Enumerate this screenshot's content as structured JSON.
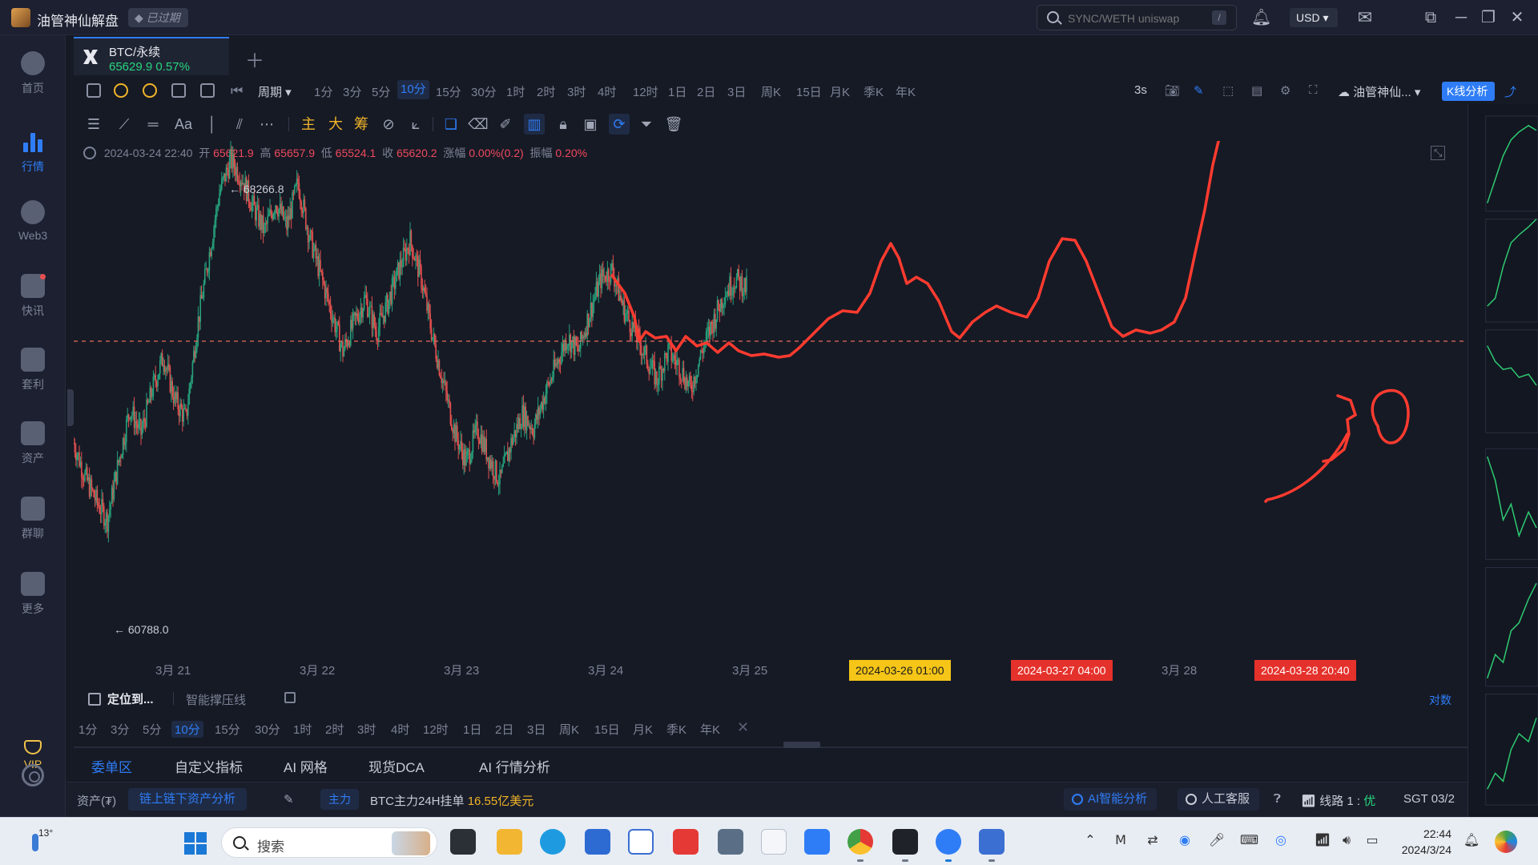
{
  "titlebar": {
    "app_name": "油管神仙解盘",
    "expired_badge": "已过期",
    "search_placeholder": "SYNC/WETH uniswap",
    "search_shortcut": "/",
    "currency": "USD"
  },
  "sidebar": {
    "items": [
      {
        "label": "首页",
        "icon": "home-icon"
      },
      {
        "label": "行情",
        "icon": "market-chart-icon"
      },
      {
        "label": "Web3",
        "icon": "web3-icon"
      },
      {
        "label": "快讯",
        "icon": "news-icon"
      },
      {
        "label": "套利",
        "icon": "arbitrage-icon"
      },
      {
        "label": "资产",
        "icon": "wallet-icon"
      },
      {
        "label": "群聊",
        "icon": "chat-icon"
      },
      {
        "label": "更多",
        "icon": "more-grid-icon"
      }
    ],
    "vip_label": "VIP"
  },
  "symbol_tab": {
    "name": "BTC/永续",
    "price_change": "65629.9  0.57%"
  },
  "toolbar1": {
    "period_label": "周期",
    "timeframes": [
      "1分",
      "3分",
      "5分",
      "10分",
      "15分",
      "30分",
      "1时",
      "2时",
      "3时",
      "4时",
      "12时",
      "1日",
      "2日",
      "3日",
      "周K",
      "15日",
      "月K",
      "季K",
      "年K"
    ],
    "active_timeframe": "10分",
    "refresh": "3s",
    "account": "油管神仙...",
    "k_analysis": "K线分析"
  },
  "toolbar2": {
    "text_tool": "Aa",
    "overlay_main": "主",
    "overlay_big": "大",
    "overlay_chips": "筹"
  },
  "ohlc": {
    "datetime": "2024-03-24 22:40",
    "open_label": "开",
    "open": "65621.9",
    "high_label": "高",
    "high": "65657.9",
    "low_label": "低",
    "low": "65524.1",
    "close_label": "收",
    "close": "65620.2",
    "change_label": "涨幅",
    "change": "0.00%(0.2)",
    "amplitude_label": "振幅",
    "amplitude": "0.20%"
  },
  "chart_data": {
    "type": "candlestick",
    "symbol": "BTC/永续",
    "interval": "10分",
    "high_marker": "← 68266.8",
    "low_marker": "← 60788.0",
    "current_price": 65620.2,
    "x_ticks": [
      "3月 21",
      "3月 22",
      "3月 23",
      "3月 24",
      "3月 25",
      "3月 28"
    ],
    "marked_dates": [
      {
        "label": "2024-03-26 01:00",
        "color": "#f5c518"
      },
      {
        "label": "2024-03-27 04:00",
        "color": "#e5312b"
      },
      {
        "label": "2024-03-28 20:40",
        "color": "#e5312b"
      }
    ],
    "closes": [
      62400,
      61700,
      61200,
      60800,
      62000,
      63100,
      62600,
      63500,
      64200,
      63300,
      62900,
      64800,
      66200,
      67600,
      68266,
      67900,
      67300,
      66800,
      67400,
      66900,
      67800,
      66700,
      65900,
      65100,
      64300,
      64900,
      65400,
      64700,
      65300,
      66000,
      66600,
      65800,
      64600,
      63600,
      62600,
      62000,
      62700,
      62100,
      61600,
      62400,
      63000,
      62700,
      63400,
      64000,
      64600,
      64300,
      65100,
      65800,
      66000,
      65200,
      64700,
      64200,
      63700,
      64300,
      64000,
      63500,
      64300,
      64900,
      65500,
      65800,
      65620
    ],
    "annotation_text": "30",
    "annotation_color": "#ff3b2f"
  },
  "bottom": {
    "locate": "定位到...",
    "smart_line": "智能撑压线",
    "log_scale": "对数",
    "timeframes": [
      "1分",
      "3分",
      "5分",
      "10分",
      "15分",
      "30分",
      "1时",
      "2时",
      "3时",
      "4时",
      "12时",
      "1日",
      "2日",
      "3日",
      "周K",
      "15日",
      "月K",
      "季K",
      "年K"
    ],
    "active_timeframe": "10分",
    "tabs": [
      "委单区",
      "自定义指标",
      "AI 网格",
      "现货DCA",
      "AI 行情分析"
    ],
    "active_tab": "委单区"
  },
  "statusbar": {
    "assets_label": "资产(₮)",
    "onchain_button": "链上链下资产分析",
    "main_badge": "主力",
    "main_text": "BTC主力24H挂单",
    "main_amount": "16.55亿美元",
    "ai_analysis": "AI智能分析",
    "support": "人工客服",
    "line_label": "线路 1 :",
    "line_quality": "优",
    "timezone": "SGT  03/2"
  },
  "taskbar": {
    "temperature": "13°",
    "search_label": "搜索",
    "time": "22:44",
    "date": "2024/3/24"
  }
}
